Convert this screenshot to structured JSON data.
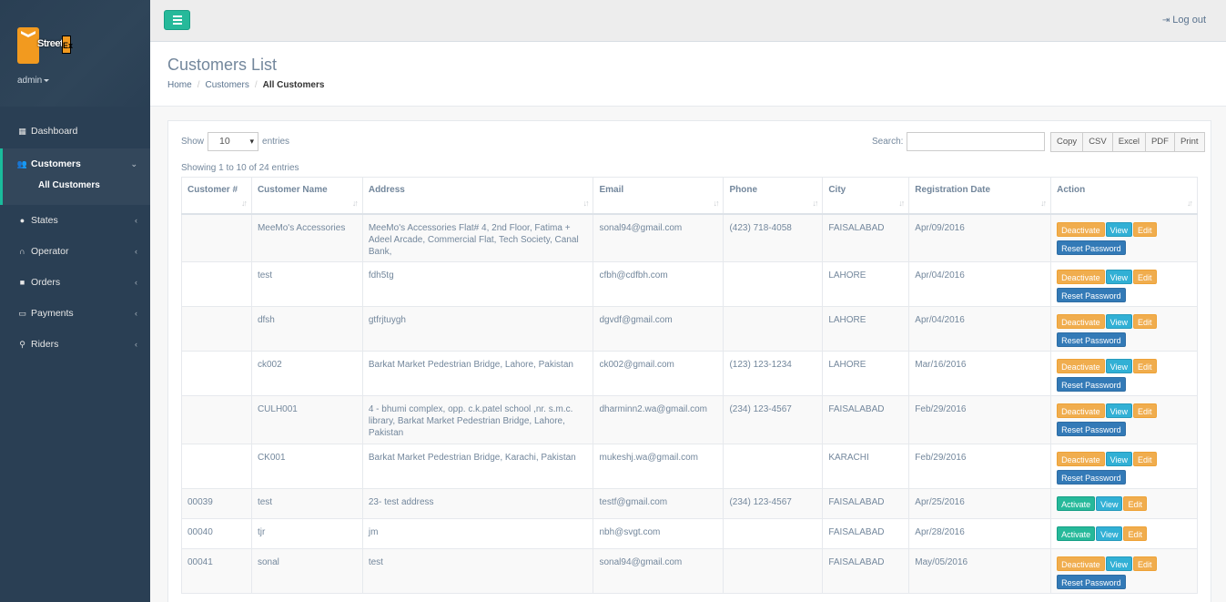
{
  "brand": {
    "logo_text": "Street",
    "logo_badge": "Ex",
    "user": "admin"
  },
  "sidebar": {
    "items": [
      {
        "label": "Dashboard",
        "icon": "th-icon"
      },
      {
        "label": "Customers",
        "icon": "users-icon",
        "sub": "All Customers"
      },
      {
        "label": "States",
        "icon": "globe-icon"
      },
      {
        "label": "Operator",
        "icon": "headset-icon"
      },
      {
        "label": "Orders",
        "icon": "truck-icon"
      },
      {
        "label": "Payments",
        "icon": "credit-card-icon"
      },
      {
        "label": "Riders",
        "icon": "motorcycle-icon"
      }
    ]
  },
  "topbar": {
    "logout": "Log out"
  },
  "page": {
    "title": "Customers List",
    "breadcrumb": [
      "Home",
      "Customers",
      "All Customers"
    ]
  },
  "controls": {
    "show_label": "Show",
    "entries_value": "10",
    "entries_label": "entries",
    "search_label": "Search:",
    "export": [
      "Copy",
      "CSV",
      "Excel",
      "PDF",
      "Print"
    ],
    "info": "Showing 1 to 10 of 24 entries"
  },
  "table": {
    "columns": [
      "Customer #",
      "Customer Name",
      "Address",
      "Email",
      "Phone",
      "City",
      "Registration Date",
      "Action"
    ],
    "rows": [
      {
        "id": "",
        "name": "MeeMo's Accessories",
        "address": "MeeMo's Accessories Flat# 4, 2nd Floor, Fatima + Adeel Arcade, Commercial Flat, Tech Society, Canal Bank,",
        "email": "sonal94@gmail.com",
        "phone": "(423) 718-4058",
        "city": "FAISALABAD",
        "date": "Apr/09/2016",
        "status": "Deactivate",
        "reset": true
      },
      {
        "id": "",
        "name": "test",
        "address": "fdh5tg",
        "email": "cfbh@cdfbh.com",
        "phone": "",
        "city": "LAHORE",
        "date": "Apr/04/2016",
        "status": "Deactivate",
        "reset": true
      },
      {
        "id": "",
        "name": "dfsh",
        "address": "gtfrjtuygh",
        "email": "dgvdf@gmail.com",
        "phone": "",
        "city": "LAHORE",
        "date": "Apr/04/2016",
        "status": "Deactivate",
        "reset": true
      },
      {
        "id": "",
        "name": "ck002",
        "address": "Barkat Market Pedestrian Bridge, Lahore, Pakistan",
        "email": "ck002@gmail.com",
        "phone": "(123) 123-1234",
        "city": "LAHORE",
        "date": "Mar/16/2016",
        "status": "Deactivate",
        "reset": true
      },
      {
        "id": "",
        "name": "CULH001",
        "address": "4 - bhumi complex, opp. c.k.patel school ,nr. s.m.c. library, Barkat Market Pedestrian Bridge, Lahore, Pakistan",
        "email": "dharminn2.wa@gmail.com",
        "phone": "(234) 123-4567",
        "city": "FAISALABAD",
        "date": "Feb/29/2016",
        "status": "Deactivate",
        "reset": true
      },
      {
        "id": "",
        "name": "CK001",
        "address": "Barkat Market Pedestrian Bridge, Karachi, Pakistan",
        "email": "mukeshj.wa@gmail.com",
        "phone": "",
        "city": "KARACHI",
        "date": "Feb/29/2016",
        "status": "Deactivate",
        "reset": true
      },
      {
        "id": "00039",
        "name": "test",
        "address": "23- test address",
        "email": "testf@gmail.com",
        "phone": "(234) 123-4567",
        "city": "FAISALABAD",
        "date": "Apr/25/2016",
        "status": "Activate",
        "reset": false
      },
      {
        "id": "00040",
        "name": "tjr",
        "address": "jm",
        "email": "nbh@svgt.com",
        "phone": "",
        "city": "FAISALABAD",
        "date": "Apr/28/2016",
        "status": "Activate",
        "reset": false
      },
      {
        "id": "00041",
        "name": "sonal",
        "address": "test",
        "email": "sonal94@gmail.com",
        "phone": "",
        "city": "FAISALABAD",
        "date": "May/05/2016",
        "status": "Deactivate",
        "reset": true
      }
    ],
    "view_label": "View",
    "edit_label": "Edit",
    "reset_label": "Reset Password"
  },
  "colors": {
    "sidebar": "#2a3f54",
    "accent": "#1abb9c",
    "warning": "#f0ad4e",
    "info": "#31b0d5",
    "primary": "#337ab7"
  }
}
